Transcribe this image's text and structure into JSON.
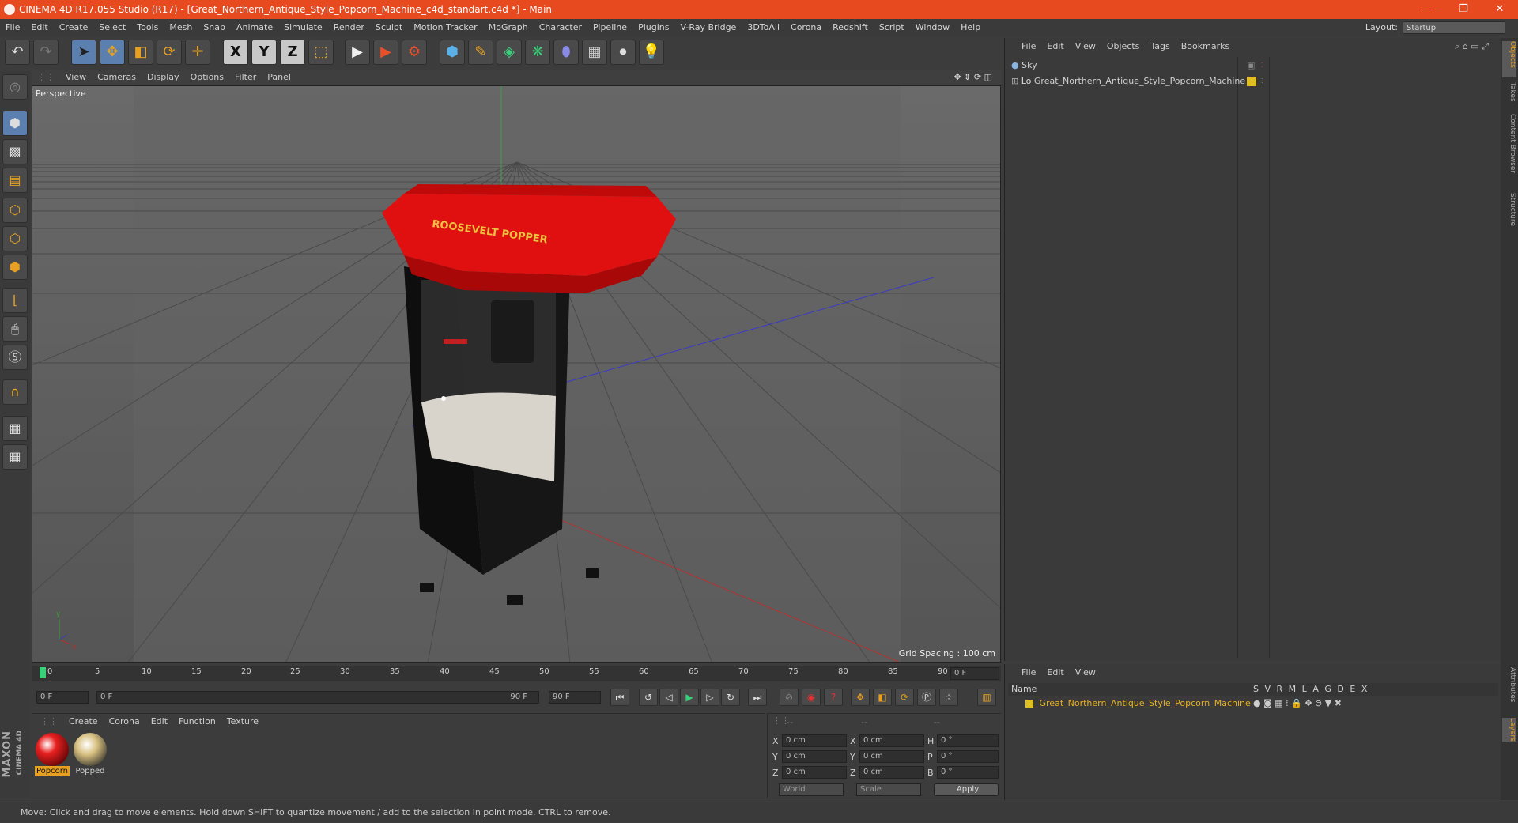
{
  "title": "CINEMA 4D R17.055 Studio (R17) - [Great_Northern_Antique_Style_Popcorn_Machine_c4d_standart.c4d *] - Main",
  "window_controls": [
    "—",
    "❐",
    "✕"
  ],
  "menu": [
    "File",
    "Edit",
    "Create",
    "Select",
    "Tools",
    "Mesh",
    "Snap",
    "Animate",
    "Simulate",
    "Render",
    "Sculpt",
    "Motion Tracker",
    "MoGraph",
    "Character",
    "Pipeline",
    "Plugins",
    "V-Ray Bridge",
    "3DToAll",
    "Corona",
    "Redshift",
    "Script",
    "Window",
    "Help"
  ],
  "layout": {
    "label": "Layout:",
    "value": "Startup"
  },
  "toolbar_icons": [
    "undo-icon",
    "redo-icon",
    "select-cursor-icon",
    "move-icon",
    "scale-icon",
    "rotate-icon",
    "live-select-icon",
    "x-axis-icon",
    "y-axis-icon",
    "z-axis-icon",
    "coordinate-system-icon",
    "render-view-icon",
    "render-picture-viewer-icon",
    "render-settings-icon",
    "cube-icon",
    "pen-icon",
    "subdivision-icon",
    "array-icon",
    "deformer-icon",
    "floor-icon",
    "camera-icon",
    "light-icon"
  ],
  "toolbar_glyphs": [
    "↶",
    "↷",
    "➤",
    "✥",
    "◧",
    "⟳",
    "✛",
    "X",
    "Y",
    "Z",
    "⬚",
    "▶",
    "▶",
    "⚙",
    "⬢",
    "✎",
    "◈",
    "❋",
    "⬮",
    "▦",
    "⏺",
    "💡"
  ],
  "viewport": {
    "menu": [
      "View",
      "Cameras",
      "Display",
      "Options",
      "Filter",
      "Panel"
    ],
    "label": "Perspective",
    "grid_spacing": "Grid Spacing : 100 cm",
    "sign_text": "ROOSEVELT POPPER"
  },
  "timeline": {
    "ticks": [
      "0",
      "5",
      "10",
      "15",
      "20",
      "25",
      "30",
      "35",
      "40",
      "45",
      "50",
      "55",
      "60",
      "65",
      "70",
      "75",
      "80",
      "85",
      "90"
    ],
    "current_frame": "0 F"
  },
  "transport": {
    "start": "0 F",
    "range_start": "0 F",
    "range_end": "90 F",
    "end": "90 F"
  },
  "materials": {
    "menu": [
      "Create",
      "Corona",
      "Edit",
      "Function",
      "Texture"
    ],
    "items": [
      "Popcorn",
      "Popped"
    ]
  },
  "coords": {
    "headers": [
      "--",
      "--",
      "--"
    ],
    "rows": [
      {
        "a": "X",
        "av": "0 cm",
        "b": "X",
        "bv": "0 cm",
        "c": "H",
        "cv": "0 °"
      },
      {
        "a": "Y",
        "av": "0 cm",
        "b": "Y",
        "bv": "0 cm",
        "c": "P",
        "cv": "0 °"
      },
      {
        "a": "Z",
        "av": "0 cm",
        "b": "Z",
        "bv": "0 cm",
        "c": "B",
        "cv": "0 °"
      }
    ],
    "world": "World",
    "scale": "Scale",
    "apply": "Apply"
  },
  "objects": {
    "menu": [
      "File",
      "Edit",
      "View",
      "Objects",
      "Tags",
      "Bookmarks"
    ],
    "items": [
      "Sky",
      "Great_Northern_Antique_Style_Popcorn_Machine"
    ]
  },
  "layers": {
    "menu": [
      "File",
      "Edit",
      "View"
    ],
    "name_header": "Name",
    "flags": [
      "S",
      "V",
      "R",
      "M",
      "L",
      "A",
      "G",
      "D",
      "E",
      "X"
    ],
    "item": "Great_Northern_Antique_Style_Popcorn_Machine"
  },
  "right_tabs": [
    "Objects",
    "Takes",
    "Content Browser",
    "Structure",
    "Attributes",
    "Layers"
  ],
  "brand": {
    "maxon": "MAXON",
    "c4d": "CINEMA 4D"
  },
  "status": "Move: Click and drag to move elements. Hold down SHIFT to quantize movement / add to the selection in point mode, CTRL to remove.",
  "colors": {
    "accent": "#e84a1f",
    "selection": "#5b7fae",
    "layer_yellow": "#e0c020"
  }
}
